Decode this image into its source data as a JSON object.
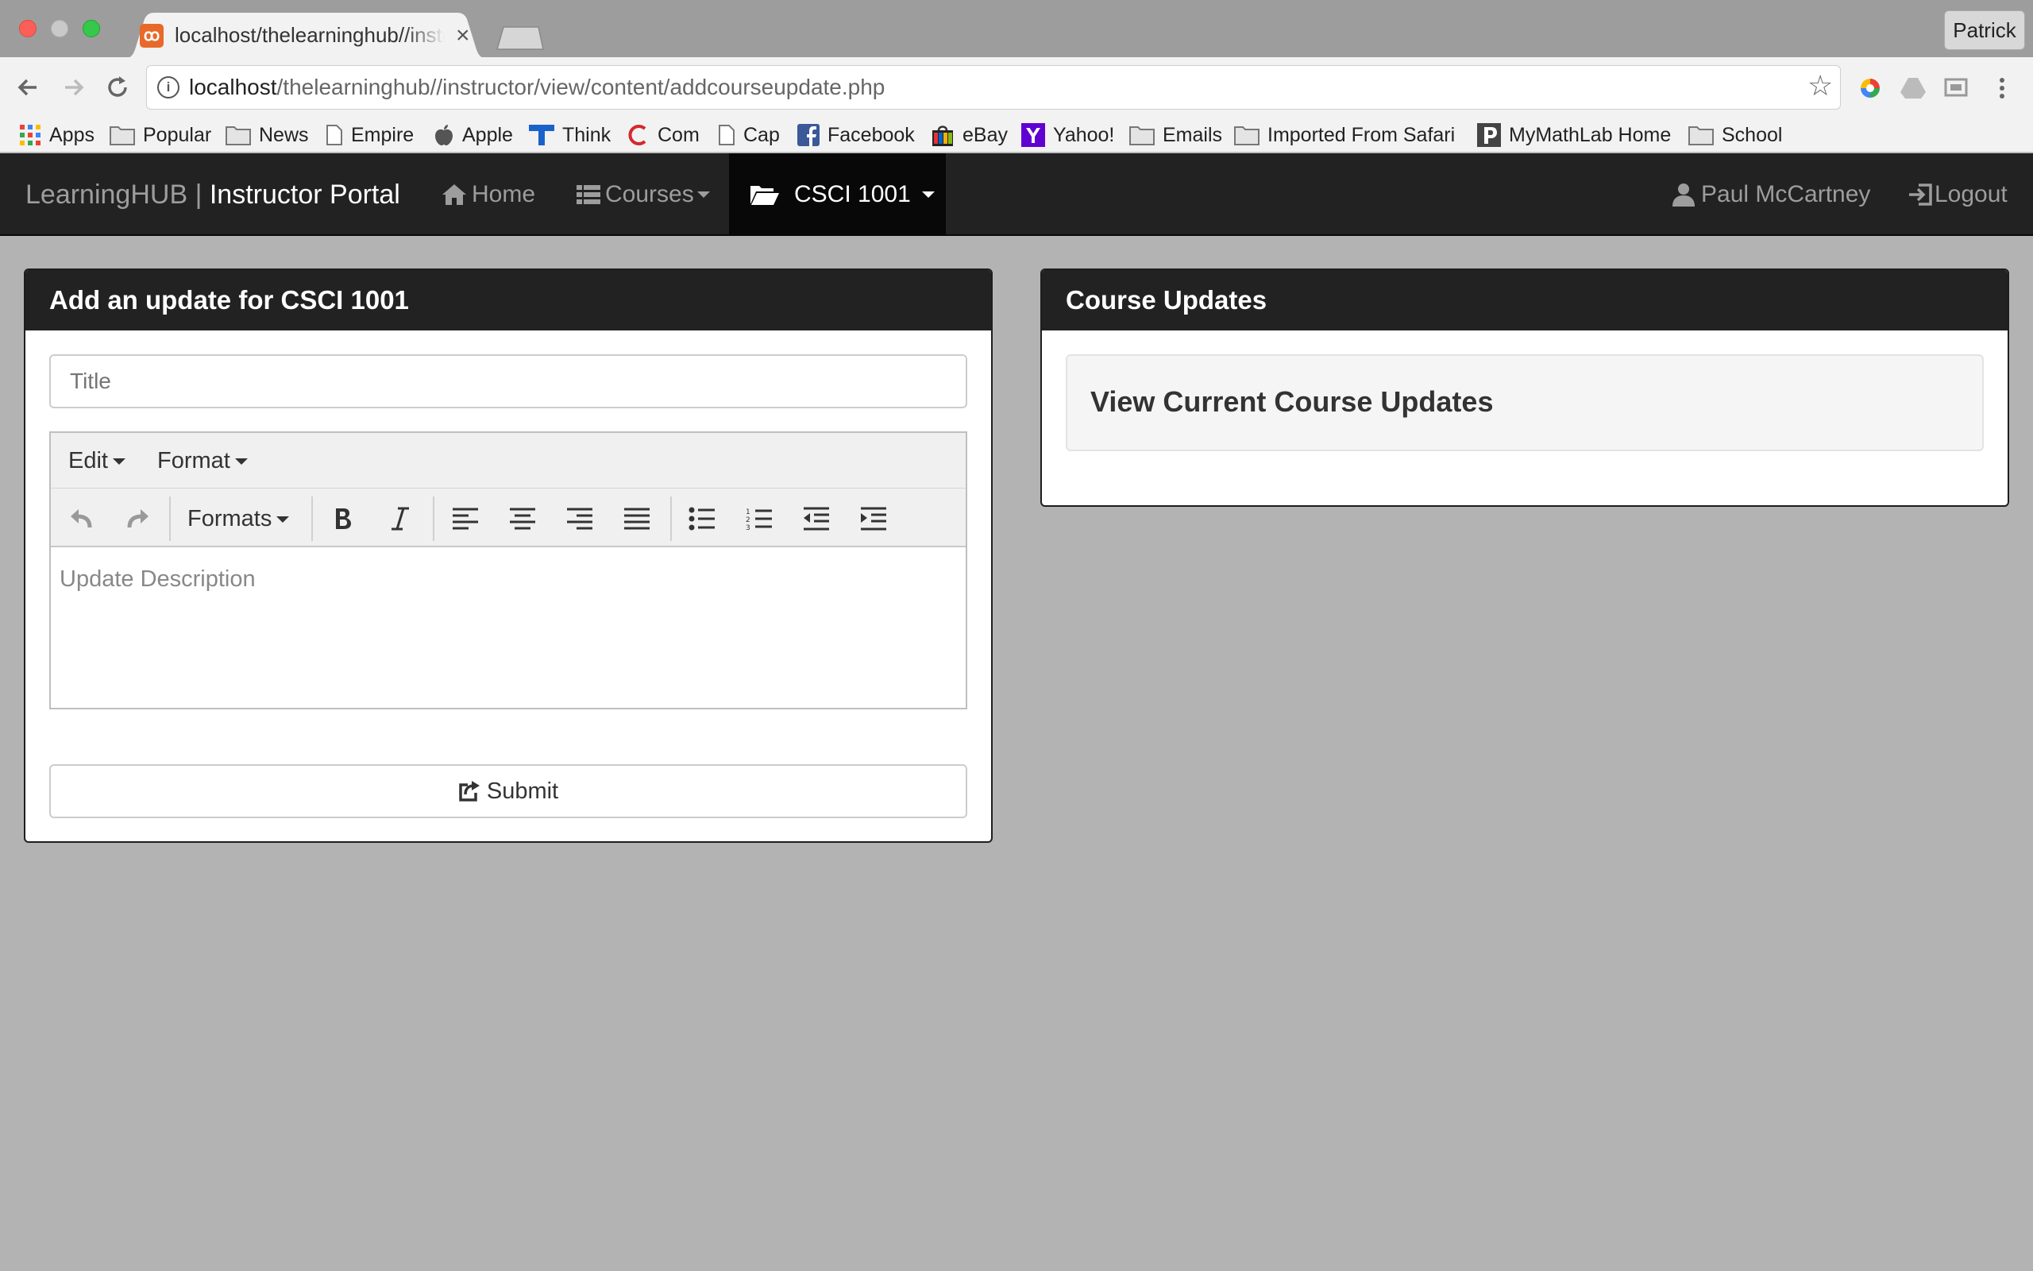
{
  "browser": {
    "tab_title": "localhost/thelearninghub//instructor/view/content/addcourseupdate.php",
    "tab_favicon": "xampp-icon",
    "profile_name": "Patrick",
    "url_host": "localhost",
    "url_path": "/thelearninghub//instructor/view/content/addcourseupdate.php",
    "bookmarks": [
      {
        "label": "Apps",
        "icon": "apps-grid-icon"
      },
      {
        "label": "Popular",
        "icon": "folder-icon"
      },
      {
        "label": "News",
        "icon": "folder-icon"
      },
      {
        "label": "Empire",
        "icon": "page-icon"
      },
      {
        "label": "Apple",
        "icon": "apple-icon"
      },
      {
        "label": "Think",
        "icon": "think-icon"
      },
      {
        "label": "Com",
        "icon": "c-icon"
      },
      {
        "label": "Cap",
        "icon": "page-icon"
      },
      {
        "label": "Facebook",
        "icon": "facebook-icon"
      },
      {
        "label": "eBay",
        "icon": "ebay-icon"
      },
      {
        "label": "Yahoo!",
        "icon": "yahoo-icon"
      },
      {
        "label": "Emails",
        "icon": "folder-icon"
      },
      {
        "label": "Imported From Safari",
        "icon": "folder-icon"
      },
      {
        "label": "MyMathLab Home",
        "icon": "pearson-icon"
      },
      {
        "label": "School",
        "icon": "folder-icon"
      }
    ]
  },
  "navbar": {
    "brand": "LearningHUB",
    "brand_sep": " | ",
    "brand_portal": "Instructor Portal",
    "home": "Home",
    "courses": "Courses",
    "current_course": "CSCI 1001",
    "user": "Paul McCartney",
    "logout": "Logout"
  },
  "add_update": {
    "heading": "Add an update for CSCI 1001",
    "title_placeholder": "Title",
    "menu_edit": "Edit",
    "menu_format": "Format",
    "formats_label": "Formats",
    "description_placeholder": "Update Description",
    "submit_label": "Submit"
  },
  "course_updates": {
    "heading": "Course Updates",
    "view_link": "View Current Course Updates"
  },
  "colors": {
    "navbar_bg": "#222222",
    "active_nav_bg": "#080808",
    "page_bg": "#b3b3b3",
    "favicon_orange": "#e8692a"
  }
}
